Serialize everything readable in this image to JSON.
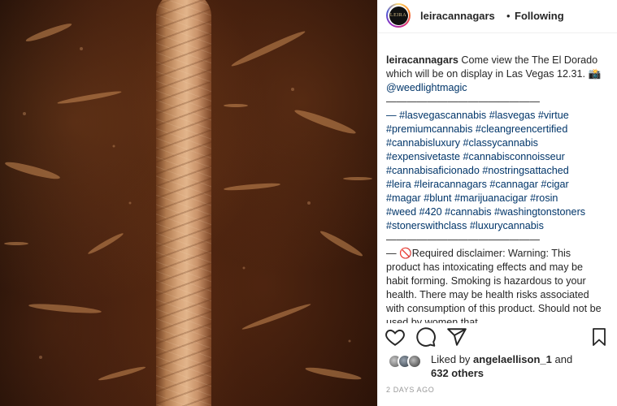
{
  "post": {
    "username": "leiracannagars",
    "follow_status": "Following",
    "dot": "•",
    "avatar_text": "LEIRA"
  },
  "caption": {
    "username": "leiracannagars",
    "text": "Come view the The El Dorado which will be on display in Las Vegas 12.31. 📸",
    "mention": "@weedlightmagic",
    "divider": "———————————————",
    "hashtags": [
      "— #lasvegascannabis #lasvegas #virtue",
      "#premiumcannabis #cleangreencertified",
      "#cannabisluxury #classycannabis",
      "#expensivetaste #cannabisconnoisseur",
      "#cannabisaficionado #nostringsattached",
      "#leira #leiracannagars #cannagar #cigar",
      "#magar #blunt #marijuanacigar #rosin",
      "#weed #420 #cannabis #washingtonstoners",
      "#stonerswithclass #luxurycannabis"
    ],
    "divider2": "———————————————",
    "disclaimer": "— 🚫Required disclaimer: Warning: This product has intoxicating effects and may be habit forming. Smoking is hazardous to your health. There may be health risks associated with consumption of this product. Should not be used by women that"
  },
  "likes": {
    "prefix": "Liked by",
    "user": "angelaellison_1",
    "conj": "and",
    "count": "632 others"
  },
  "timestamp": "2 DAYS AGO",
  "icons": [
    "heart-icon",
    "comment-icon",
    "share-icon",
    "bookmark-icon"
  ]
}
